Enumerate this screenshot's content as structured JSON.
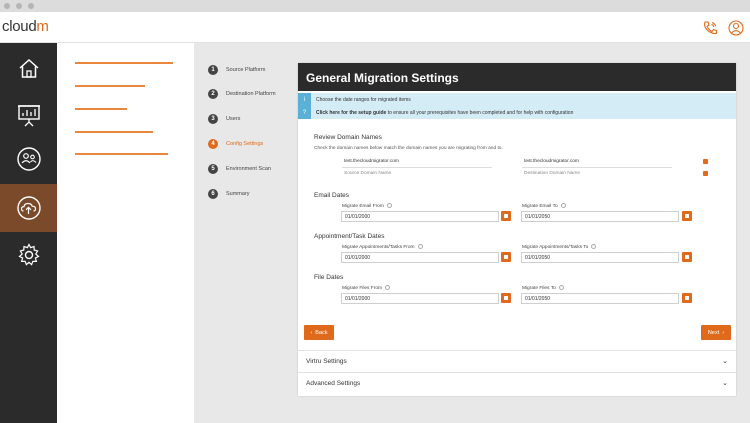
{
  "app": {
    "logo_text": "cloud",
    "logo_accent": "m"
  },
  "header_icons": [
    "phone-icon",
    "user-profile-icon"
  ],
  "nav": [
    {
      "name": "home-icon"
    },
    {
      "name": "presentation-icon"
    },
    {
      "name": "users-icon"
    },
    {
      "name": "cloud-upload-icon",
      "active": true
    },
    {
      "name": "gear-icon"
    }
  ],
  "steps": [
    {
      "num": "1",
      "label": "Source Platform"
    },
    {
      "num": "2",
      "label": "Destination Platform"
    },
    {
      "num": "3",
      "label": "Users"
    },
    {
      "num": "4",
      "label": "Config Settings",
      "active": true
    },
    {
      "num": "5",
      "label": "Environment Scan"
    },
    {
      "num": "6",
      "label": "Summary"
    }
  ],
  "card": {
    "title": "General Migration Settings",
    "info1": "Choose the date ranges for migrated items",
    "info2_bold": "Click here for the setup guide",
    "info2_rest": " to ensure all your prerequisites have been completed and for help with configuration"
  },
  "domains": {
    "title": "Review Domain Names",
    "hint": "Check the domain names below match the domain names you are migrating from and to.",
    "source_value": "test.thecloudmigrator.com",
    "dest_value": "test.thecloudmigrator.com",
    "source_placeholder": "Source Domain Name",
    "dest_placeholder": "Destination Domain Name"
  },
  "email": {
    "title": "Email Dates",
    "from_label": "Migrate Email From",
    "to_label": "Migrate Email To",
    "from_value": "01/01/2000",
    "to_value": "01/01/2050"
  },
  "appointments": {
    "title": "Appointment/Task Dates",
    "from_label": "Migrate Appointments/Tasks From",
    "to_label": "Migrate Appointments/Tasks To",
    "from_value": "01/01/2000",
    "to_value": "01/01/2050"
  },
  "files": {
    "title": "File Dates",
    "from_label": "Migrate Files From",
    "to_label": "Migrate Files To",
    "from_value": "01/01/2000",
    "to_value": "01/01/2050"
  },
  "buttons": {
    "back": "Back",
    "next": "Next"
  },
  "accordions": {
    "virtru": "Virtru Settings",
    "advanced": "Advanced Settings"
  },
  "colors": {
    "accent": "#e06a1b",
    "dark": "#2b2b2b",
    "info_bg": "#d4ecf6"
  }
}
